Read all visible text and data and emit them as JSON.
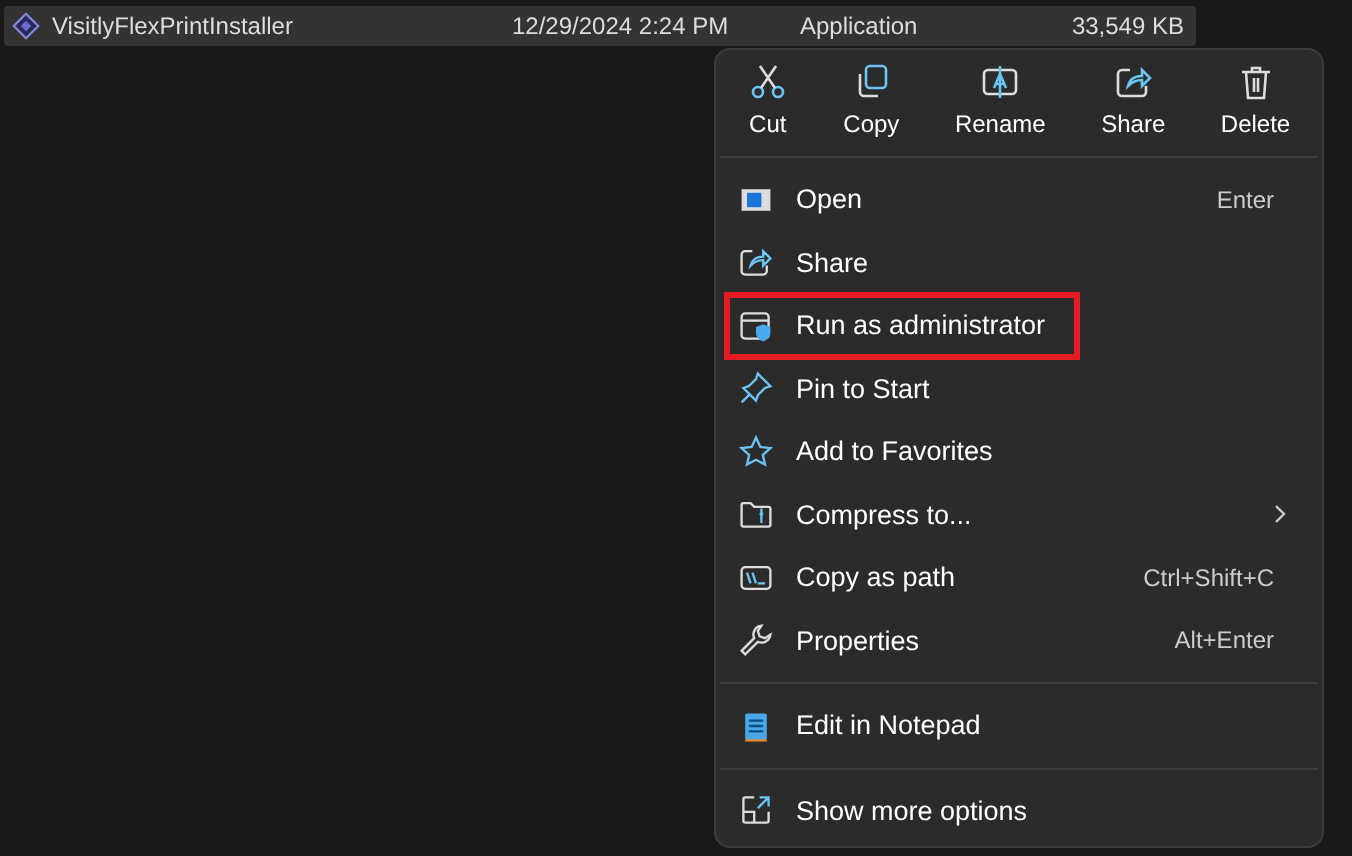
{
  "file_row": {
    "name": "VisitlyFlexPrintInstaller",
    "date": "12/29/2024 2:24 PM",
    "type": "Application",
    "size": "33,549 KB",
    "selected": true
  },
  "context_menu": {
    "actions": [
      {
        "label": "Cut"
      },
      {
        "label": "Copy"
      },
      {
        "label": "Rename"
      },
      {
        "label": "Share"
      },
      {
        "label": "Delete"
      }
    ],
    "groups": [
      [
        {
          "label": "Open",
          "shortcut": "Enter",
          "highlighted": false,
          "submenu": false
        },
        {
          "label": "Share",
          "highlighted": false,
          "submenu": false
        },
        {
          "label": "Run as administrator",
          "highlighted": true,
          "submenu": false
        },
        {
          "label": "Pin to Start",
          "highlighted": false,
          "submenu": false
        },
        {
          "label": "Add to Favorites",
          "highlighted": false,
          "submenu": false
        },
        {
          "label": "Compress to...",
          "highlighted": false,
          "submenu": true
        },
        {
          "label": "Copy as path",
          "shortcut": "Ctrl+Shift+C",
          "highlighted": false,
          "submenu": false
        },
        {
          "label": "Properties",
          "shortcut": "Alt+Enter",
          "highlighted": false,
          "submenu": false
        }
      ],
      [
        {
          "label": "Edit in Notepad",
          "highlighted": false,
          "submenu": false
        }
      ],
      [
        {
          "label": "Show more options",
          "highlighted": false,
          "submenu": false
        }
      ]
    ]
  }
}
